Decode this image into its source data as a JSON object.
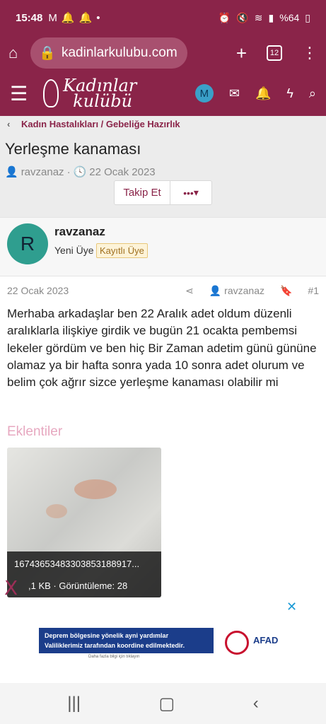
{
  "status_bar": {
    "time": "15:48",
    "battery": "%64"
  },
  "browser": {
    "url": "kadinlarkulubu.com",
    "tab_count": "12"
  },
  "site": {
    "logo_line1": "Kadınlar",
    "logo_line2": "kulübü",
    "account_initial": "M"
  },
  "breadcrumb": {
    "label": "Kadın Hastalıkları / Gebeliğe Hazırlık"
  },
  "thread": {
    "title": "Yerleşme kanaması",
    "author": "ravzanaz",
    "date": "22 Ocak 2023",
    "follow_label": "Takip Et",
    "more_label": "•••"
  },
  "post": {
    "avatar_initial": "R",
    "username": "ravzanaz",
    "user_title": "Yeni Üye",
    "badge": "Kayıtlı Üye",
    "date": "22 Ocak 2023",
    "author": "ravzanaz",
    "number": "#1",
    "body": "Merhaba arkadaşlar ben 22 Aralık adet oldum düzenli aralıklarla ilişkiye girdik ve bugün 21 ocakta pembemsi lekeler gördüm ve ben hiç Bir Zaman adetim günü gününe olamaz ya bir hafta sonra yada 10 sonra adet olurum ve belim çok ağrır sizce yerleşme kanaması olabilir mi",
    "attachments_label": "Eklentiler",
    "attachment": {
      "filename": "16743653483303853188917...",
      "info": ",1 KB · Görüntüleme: 28"
    }
  },
  "ad": {
    "close": "✕",
    "line1": "Deprem bölgesine yönelik ayni yardımlar",
    "line2": "Valiliklerimiz tarafından koordine edilmektedir.",
    "sub": "Daha fazla bilgi için tıklayın",
    "brand": "AFAD"
  },
  "close_overlay": "X"
}
